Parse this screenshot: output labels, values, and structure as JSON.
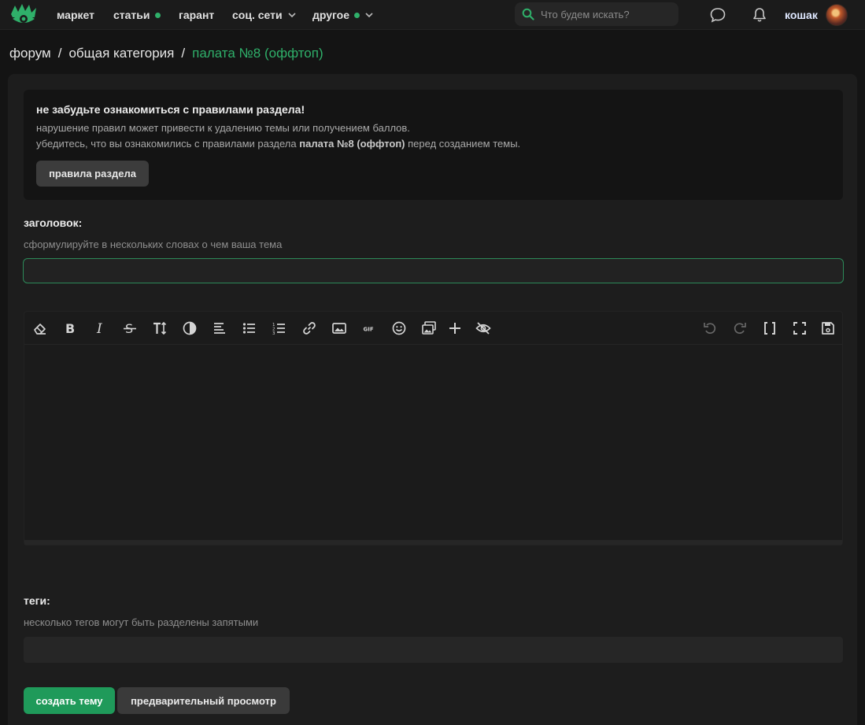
{
  "nav": {
    "items": [
      {
        "label": "маркет",
        "dot": false,
        "chevron": false
      },
      {
        "label": "статьи",
        "dot": true,
        "chevron": false
      },
      {
        "label": "гарант",
        "dot": false,
        "chevron": false
      },
      {
        "label": "соц. сети",
        "dot": false,
        "chevron": true
      },
      {
        "label": "другое",
        "dot": true,
        "chevron": true
      }
    ],
    "search_placeholder": "Что будем искать?",
    "username": "кошак",
    "accent_color": "#2fb06a"
  },
  "breadcrumb": {
    "items": [
      "форум",
      "общая категория"
    ],
    "separator": "/",
    "current": "палата №8 (оффтоп)"
  },
  "notice": {
    "title": "не забудьте ознакомиться с правилами раздела!",
    "line1": "нарушение правил может привести к удалению темы или получением баллов.",
    "line2_prefix": "убедитесь, что вы ознакомились с правилами раздела",
    "line2_bold": "палата №8 (оффтоп)",
    "line2_suffix": "перед созданием темы.",
    "button": "правила раздела"
  },
  "title_field": {
    "label": "заголовок:",
    "hint": "сформулируйте в нескольких словах о чем ваша тема",
    "value": ""
  },
  "editor": {
    "toolbar_left": [
      "eraser-icon",
      "bold-icon",
      "italic-icon",
      "strikethrough-icon",
      "text-size-icon",
      "color-icon",
      "align-left-icon",
      "bullet-list-icon",
      "numbered-list-icon",
      "link-icon",
      "image-icon",
      "gif-icon",
      "emoji-icon",
      "gallery-icon",
      "plus-icon",
      "hide-icon"
    ],
    "toolbar_right": [
      "undo-icon",
      "redo-icon",
      "source-code-icon",
      "fullscreen-icon",
      "save-draft-icon"
    ],
    "gif_text": "GIF",
    "content": ""
  },
  "tags_field": {
    "label": "теги:",
    "hint": "несколько тегов могут быть разделены запятыми",
    "value": ""
  },
  "actions": {
    "create": "создать тему",
    "preview": "предварительный просмотр",
    "primary_color": "#1f9a5a"
  }
}
